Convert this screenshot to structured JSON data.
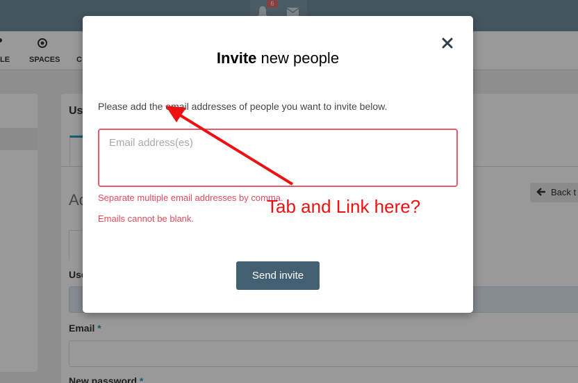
{
  "topbar": {
    "notification_count": "6",
    "icons": [
      "bell-icon",
      "mail-icon"
    ]
  },
  "navbar": {
    "items": [
      {
        "label": "LE",
        "icon": "profile-icon"
      },
      {
        "label": "SPACES",
        "icon": "target-icon"
      },
      {
        "label": "C",
        "icon": ""
      }
    ]
  },
  "background": {
    "panel_title": "Us",
    "section_title": "Ac",
    "back_button": "Back t",
    "field_user_label": "Use",
    "field_email_label": "Email",
    "field_password_label": "New password",
    "required_mark": "*"
  },
  "modal": {
    "title_bold": "Invite",
    "title_rest": "new people",
    "description": "Please add the email addresses of people you want to invite below.",
    "email_placeholder": "Email address(es)",
    "email_value": "",
    "hint": "Separate multiple email addresses by comma.",
    "error": "Emails cannot be blank.",
    "send_button": "Send invite"
  },
  "annotation": {
    "text": "Tab and Link here?",
    "color": "#ee1111"
  },
  "colors": {
    "topbar": "#708fa0",
    "accent": "#21a1b3",
    "send_button": "#435f72",
    "error": "#e24a5a"
  }
}
